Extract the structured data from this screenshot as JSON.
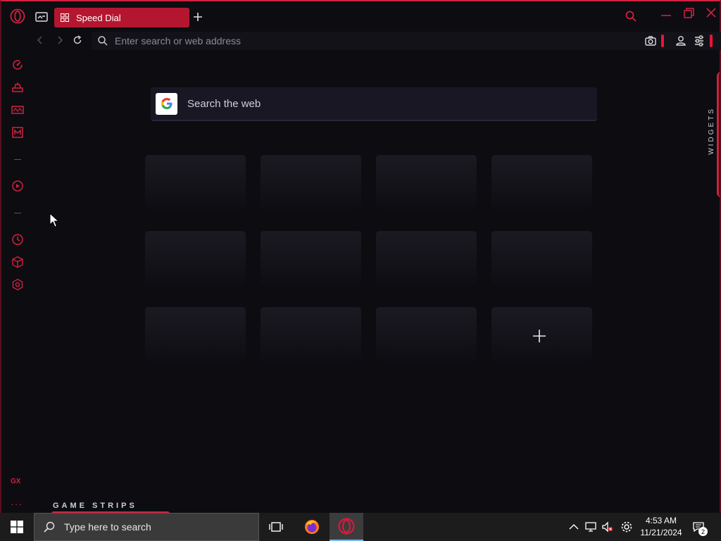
{
  "browser": {
    "tab": {
      "label": "Speed Dial"
    },
    "address_bar": {
      "placeholder": "Enter search or web address"
    }
  },
  "sidebar": {
    "items": [
      {
        "icon": "speed-dial-icon"
      },
      {
        "icon": "gx-control-icon"
      },
      {
        "icon": "gx-corner-icon"
      },
      {
        "icon": "messenger-icon"
      },
      {
        "icon": "player-icon"
      },
      {
        "icon": "history-icon"
      },
      {
        "icon": "extensions-icon"
      },
      {
        "icon": "settings-icon"
      }
    ],
    "gx_label": "GX",
    "more_label": "···"
  },
  "content": {
    "search_box_text": "Search the web",
    "widgets_label": "WIDGETS",
    "game_strips_label": "GAME STRIPS",
    "speed_dial_tiles": 12,
    "add_tile_symbol": "+"
  },
  "taskbar": {
    "search_text": "Type here to search",
    "time": "4:53 AM",
    "date": "11/21/2024",
    "notification_count": "2",
    "apps": [
      "task-view",
      "firefox",
      "opera-gx"
    ]
  },
  "colors": {
    "accent": "#d0213f",
    "background": "#0d0c11",
    "tab_active": "#b5162f"
  }
}
